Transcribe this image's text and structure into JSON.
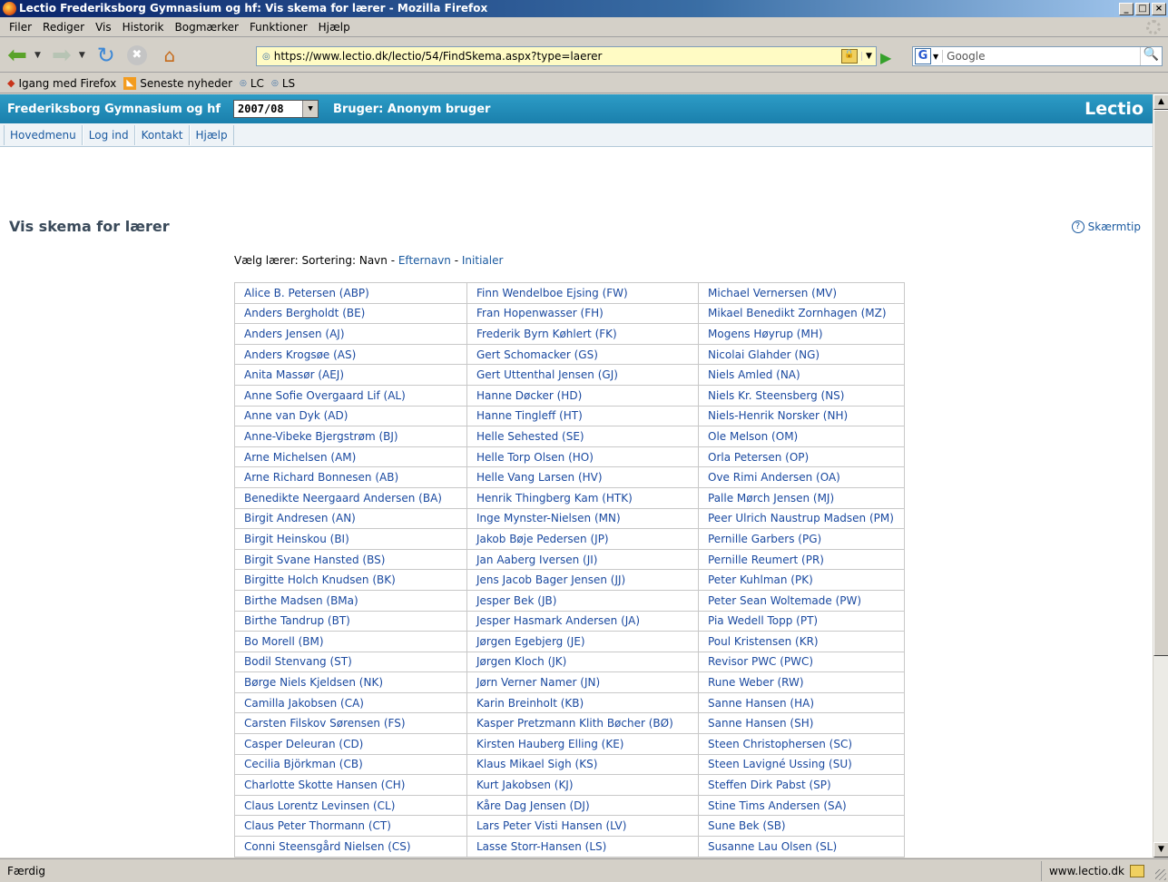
{
  "window": {
    "title": "Lectio Frederiksborg Gymnasium og hf: Vis skema for lærer - Mozilla Firefox",
    "buttons": [
      "_",
      "□",
      "×"
    ]
  },
  "menu": [
    "Filer",
    "Rediger",
    "Vis",
    "Historik",
    "Bogmærker",
    "Funktioner",
    "Hjælp"
  ],
  "navbar": {
    "url": "https://www.lectio.dk/lectio/54/FindSkema.aspx?type=laerer",
    "search_placeholder": "Google"
  },
  "bookmarks": [
    {
      "label": "Igang med Firefox",
      "icon": "firefox-icon"
    },
    {
      "label": "Seneste nyheder",
      "icon": "rss-icon"
    },
    {
      "label": "LC",
      "icon": "lectio-icon"
    },
    {
      "label": "LS",
      "icon": "lectio-icon"
    }
  ],
  "lectio": {
    "school": "Frederiksborg Gymnasium og hf",
    "year": "2007/08",
    "user": "Bruger: Anonym bruger",
    "logo": "Lectio",
    "tabs": [
      "Hovedmenu",
      "Log ind",
      "Kontakt",
      "Hjælp"
    ],
    "page_title": "Vis skema for lærer",
    "help": "Skærmtip",
    "sort": {
      "prefix": "Vælg lærer: Sortering: Navn - ",
      "link1": "Efternavn",
      "sep": " - ",
      "link2": "Initialer"
    }
  },
  "teachers": [
    [
      "Alice B. Petersen (ABP)",
      "Finn Wendelboe Ejsing (FW)",
      "Michael Vernersen (MV)"
    ],
    [
      "Anders Bergholdt (BE)",
      "Fran Hopenwasser (FH)",
      "Mikael Benedikt Zornhagen (MZ)"
    ],
    [
      "Anders Jensen (AJ)",
      "Frederik Byrn Køhlert (FK)",
      "Mogens Høyrup (MH)"
    ],
    [
      "Anders Krogsøe (AS)",
      "Gert Schomacker (GS)",
      "Nicolai Glahder (NG)"
    ],
    [
      "Anita Massør (AEJ)",
      "Gert Uttenthal Jensen (GJ)",
      "Niels Amled (NA)"
    ],
    [
      "Anne Sofie Overgaard Lif (AL)",
      "Hanne Døcker (HD)",
      "Niels Kr. Steensberg (NS)"
    ],
    [
      "Anne van Dyk (AD)",
      "Hanne Tingleff (HT)",
      "Niels-Henrik Norsker (NH)"
    ],
    [
      "Anne-Vibeke Bjergstrøm (BJ)",
      "Helle Sehested (SE)",
      "Ole Melson (OM)"
    ],
    [
      "Arne Michelsen (AM)",
      "Helle Torp Olsen (HO)",
      "Orla Petersen (OP)"
    ],
    [
      "Arne Richard Bonnesen (AB)",
      "Helle Vang Larsen (HV)",
      "Ove Rimi Andersen (OA)"
    ],
    [
      "Benedikte Neergaard Andersen (BA)",
      "Henrik Thingberg Kam (HTK)",
      "Palle Mørch Jensen (MJ)"
    ],
    [
      "Birgit Andresen (AN)",
      "Inge Mynster-Nielsen (MN)",
      "Peer Ulrich Naustrup Madsen (PM)"
    ],
    [
      "Birgit Heinskou (BI)",
      "Jakob Bøje Pedersen (JP)",
      "Pernille Garbers (PG)"
    ],
    [
      "Birgit Svane Hansted (BS)",
      "Jan Aaberg Iversen (JI)",
      "Pernille Reumert (PR)"
    ],
    [
      "Birgitte Holch Knudsen (BK)",
      "Jens Jacob Bager Jensen (JJ)",
      "Peter Kuhlman (PK)"
    ],
    [
      "Birthe Madsen (BMa)",
      "Jesper Bek (JB)",
      "Peter Sean Woltemade (PW)"
    ],
    [
      "Birthe Tandrup (BT)",
      "Jesper Hasmark Andersen (JA)",
      "Pia Wedell Topp (PT)"
    ],
    [
      "Bo Morell (BM)",
      "Jørgen Egebjerg (JE)",
      "Poul Kristensen (KR)"
    ],
    [
      "Bodil Stenvang (ST)",
      "Jørgen Kloch (JK)",
      "Revisor PWC (PWC)"
    ],
    [
      "Børge Niels Kjeldsen (NK)",
      "Jørn Verner Namer (JN)",
      "Rune Weber (RW)"
    ],
    [
      "Camilla Jakobsen (CA)",
      "Karin Breinholt (KB)",
      "Sanne Hansen (HA)"
    ],
    [
      "Carsten Filskov Sørensen (FS)",
      "Kasper Pretzmann Klith Bøcher (BØ)",
      "Sanne Hansen (SH)"
    ],
    [
      "Casper Deleuran (CD)",
      "Kirsten Hauberg Elling (KE)",
      "Steen Christophersen (SC)"
    ],
    [
      "Cecilia Björkman (CB)",
      "Klaus Mikael Sigh (KS)",
      "Steen Lavigné Ussing (SU)"
    ],
    [
      "Charlotte Skotte Hansen (CH)",
      "Kurt Jakobsen (KJ)",
      "Steffen Dirk Pabst (SP)"
    ],
    [
      "Claus Lorentz Levinsen (CL)",
      "Kåre Dag Jensen (DJ)",
      "Stine Tims Andersen (SA)"
    ],
    [
      "Claus Peter Thormann (CT)",
      "Lars Peter Visti Hansen (LV)",
      "Sune Bek (SB)"
    ],
    [
      "Conni Steensgård Nielsen (CS)",
      "Lasse Storr-Hansen (LS)",
      "Susanne Lau Olsen (SL)"
    ]
  ],
  "status": {
    "text": "Færdig",
    "site": "www.lectio.dk"
  }
}
